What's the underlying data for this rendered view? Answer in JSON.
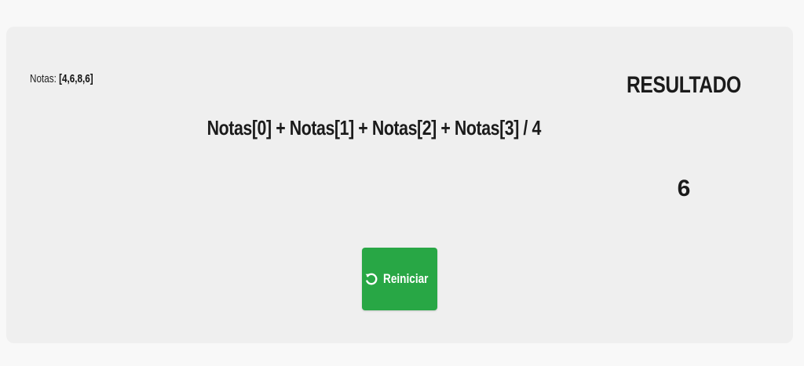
{
  "notas": {
    "label": "Notas:",
    "array": "[4,6,8,6]"
  },
  "formula": "Notas[0] + Notas[1] + Notas[2] + Notas[3] / 4",
  "result": {
    "title": "RESULTADO",
    "value": "6"
  },
  "reset_button": {
    "label": "Reiniciar",
    "icon": "redo-icon",
    "color": "#28a745"
  }
}
